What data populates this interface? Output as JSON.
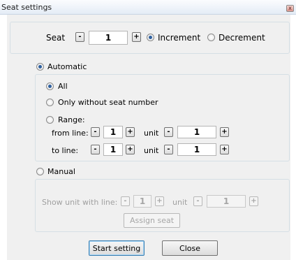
{
  "window": {
    "title": "Seat settings",
    "close_glyph": "x"
  },
  "seat_row": {
    "label": "Seat",
    "minus": "-",
    "value": "1",
    "plus": "+",
    "increment_label": "Increment",
    "decrement_label": "Decrement",
    "selected": "increment"
  },
  "automatic": {
    "label": "Automatic",
    "selected": true,
    "options": {
      "all": "All",
      "only_without": "Only without seat number",
      "range": "Range:"
    },
    "selected_option": "all",
    "from_line": {
      "label": "from line:",
      "minus": "-",
      "value": "1",
      "plus": "+",
      "unit_label": "unit",
      "unit_minus": "-",
      "unit_value": "1",
      "unit_plus": "+"
    },
    "to_line": {
      "label": "to line:",
      "minus": "-",
      "value": "1",
      "plus": "+",
      "unit_label": "unit",
      "unit_minus": "-",
      "unit_value": "1",
      "unit_plus": "+"
    }
  },
  "manual": {
    "label": "Manual",
    "selected": false,
    "show_unit_label": "Show unit with line:",
    "minus": "-",
    "value": "1",
    "plus": "+",
    "unit_label": "unit",
    "unit_minus": "-",
    "unit_value": "1",
    "unit_plus": "+",
    "assign_button": "Assign seat"
  },
  "footer": {
    "start_button": "Start setting",
    "close_button": "Close"
  }
}
